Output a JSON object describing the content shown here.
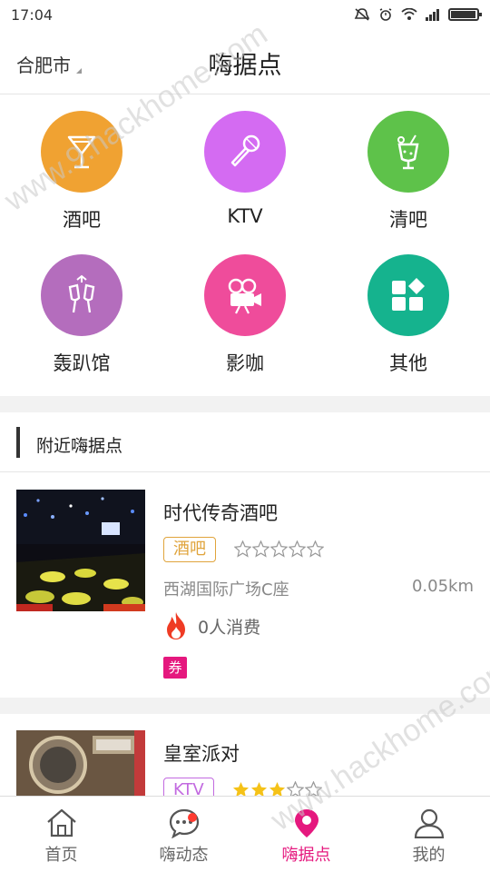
{
  "status_bar": {
    "time": "17:04"
  },
  "header": {
    "city": "合肥市",
    "title": "嗨据点"
  },
  "categories": [
    {
      "label": "酒吧",
      "color": "#f0a232",
      "icon": "cocktail-icon"
    },
    {
      "label": "KTV",
      "color": "#d46bf2",
      "icon": "microphone-icon"
    },
    {
      "label": "清吧",
      "color": "#5ec24a",
      "icon": "drink-icon"
    },
    {
      "label": "轰趴馆",
      "color": "#b46dbd",
      "icon": "champagne-icon"
    },
    {
      "label": "影咖",
      "color": "#ef4c9b",
      "icon": "film-camera-icon"
    },
    {
      "label": "其他",
      "color": "#15b38e",
      "icon": "grid-icon"
    }
  ],
  "section": {
    "title": "附近嗨据点"
  },
  "venues": [
    {
      "name": "时代传奇酒吧",
      "tag": "酒吧",
      "tag_color": "#e0a43c",
      "rating": 0,
      "address": "西湖国际广场C座",
      "distance": "0.05km",
      "consume": "0人消费",
      "coupon": "券"
    },
    {
      "name": "皇室派对",
      "tag": "KTV",
      "tag_color": "#c26ae0",
      "rating": 3
    }
  ],
  "watermarks": [
    "www.9.hackhome.com",
    "www.hackhome.com"
  ],
  "nav": [
    {
      "label": "首页",
      "icon": "home-icon"
    },
    {
      "label": "嗨动态",
      "icon": "chat-icon"
    },
    {
      "label": "嗨据点",
      "icon": "location-pin-icon"
    },
    {
      "label": "我的",
      "icon": "user-icon"
    }
  ],
  "colors": {
    "accent": "#e5187e",
    "star": "#f5c218"
  }
}
